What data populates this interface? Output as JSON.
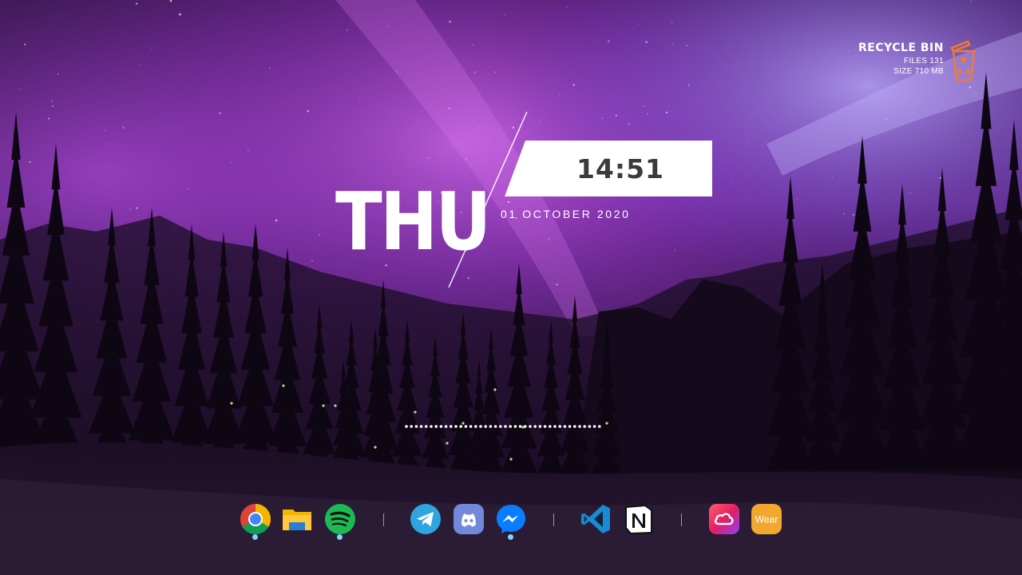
{
  "recycle_bin": {
    "title": "RECYCLE BIN",
    "files_label": "FILES 131",
    "size_label": "SIZE 710 MB",
    "icon": "recycle-bin-icon",
    "accent_color": "#f07b2c"
  },
  "clock": {
    "day": "THU",
    "time": "14:51",
    "date": "01 OCTOBER 2020"
  },
  "dock": {
    "groups": [
      [
        {
          "name": "Google Chrome",
          "icon": "chrome-icon",
          "running": true
        },
        {
          "name": "File Explorer",
          "icon": "folder-icon",
          "running": false
        },
        {
          "name": "Spotify",
          "icon": "spotify-icon",
          "running": true
        }
      ],
      [
        {
          "name": "Telegram",
          "icon": "telegram-icon",
          "running": false
        },
        {
          "name": "Discord",
          "icon": "discord-icon",
          "running": false
        },
        {
          "name": "Messenger",
          "icon": "messenger-icon",
          "running": true
        }
      ],
      [
        {
          "name": "Visual Studio Code",
          "icon": "vscode-icon",
          "running": false
        },
        {
          "name": "Notion",
          "icon": "notion-icon",
          "running": false
        }
      ],
      [
        {
          "name": "Adobe Creative Cloud",
          "icon": "creative-cloud-icon",
          "running": false
        },
        {
          "name": "Wear",
          "icon": "wear-icon",
          "label": "Wear",
          "running": false
        }
      ]
    ]
  },
  "colors": {
    "sky_purple": "#7a2ea8",
    "aurora": "#c04fe0",
    "running_indicator": "#7fd3ff"
  }
}
